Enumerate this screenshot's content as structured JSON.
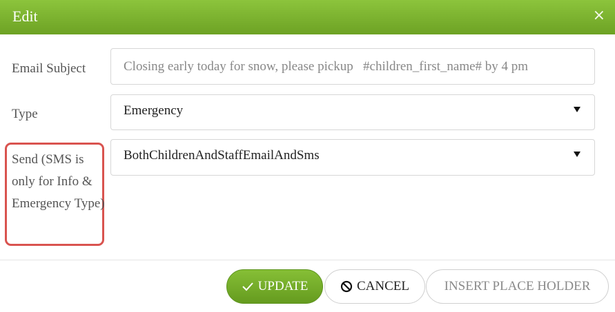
{
  "dialog": {
    "title": "Edit",
    "close_glyph": "×"
  },
  "form": {
    "email_subject": {
      "label": "Email Subject",
      "value": "Closing early today for snow, please pickup   #children_first_name# by 4 pm"
    },
    "type": {
      "label": "Type",
      "value": "Emergency"
    },
    "send": {
      "label": "Send (SMS is only for Info & Emergency Type)",
      "value": "BothChildrenAndStaffEmailAndSms"
    }
  },
  "buttons": {
    "update": "UPDATE",
    "cancel": "CANCEL",
    "insert": "INSERT PLACE HOLDER"
  },
  "colors": {
    "accent_green": "#76ad2a",
    "highlight_red": "#d9534f"
  },
  "icons": {
    "update": "check-icon",
    "cancel": "ban-icon",
    "close": "close-icon",
    "dropdown": "caret-down-icon"
  }
}
